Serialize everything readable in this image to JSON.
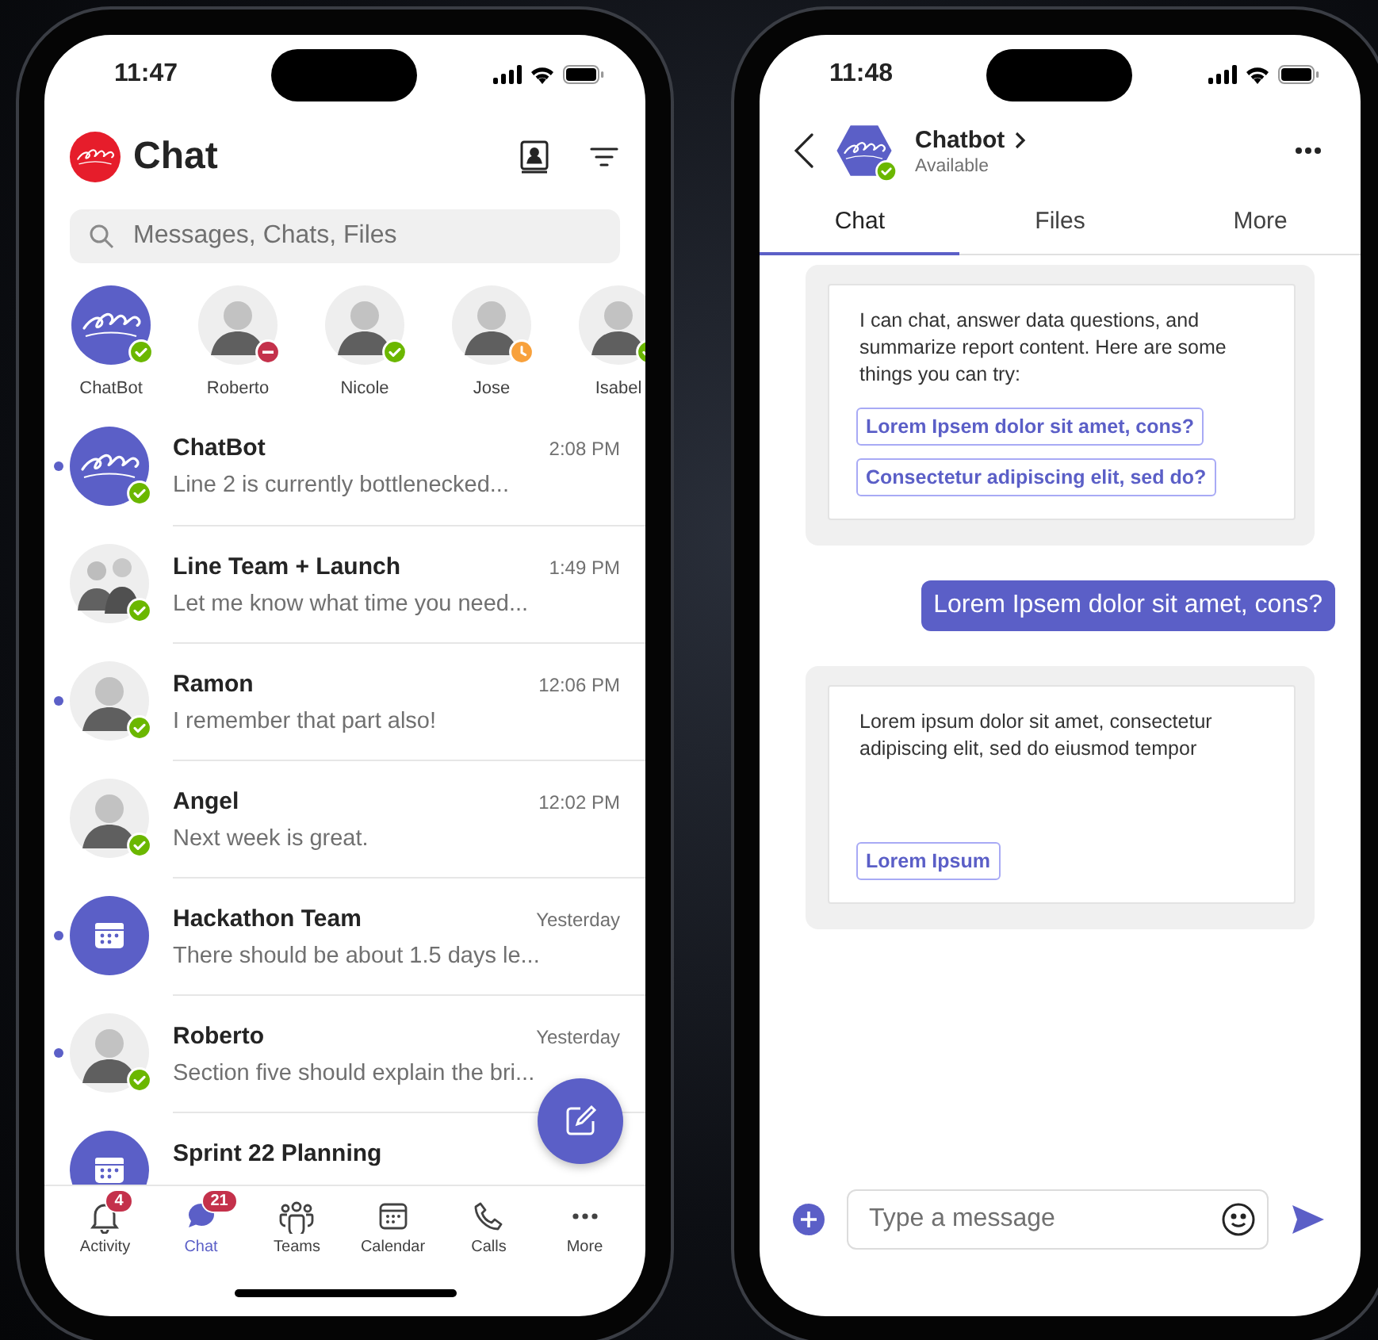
{
  "chat_list_screen": {
    "status_bar": {
      "time": "11:47"
    },
    "header": {
      "title": "Chat"
    },
    "search": {
      "placeholder": "Messages, Chats, Files"
    },
    "contacts": [
      {
        "name": "ChatBot",
        "kind": "logo",
        "presence": {
          "kind": "available",
          "color": "#6bb700"
        }
      },
      {
        "name": "Roberto",
        "kind": "person",
        "presence": {
          "kind": "busy",
          "color": "#c4314b"
        }
      },
      {
        "name": "Nicole",
        "kind": "person",
        "presence": {
          "kind": "available",
          "color": "#6bb700"
        }
      },
      {
        "name": "Jose",
        "kind": "person",
        "presence": {
          "kind": "away",
          "color": "#f8a13c"
        }
      },
      {
        "name": "Isabel",
        "kind": "person",
        "presence": {
          "kind": "available",
          "color": "#6bb700"
        }
      }
    ],
    "chats": [
      {
        "name": "ChatBot",
        "time": "2:08 PM",
        "preview": "Line 2 is currently bottlenecked...",
        "unread": true,
        "kind": "logo",
        "presence": {
          "kind": "available",
          "color": "#6bb700"
        }
      },
      {
        "name": "Line Team + Launch",
        "time": "1:49 PM",
        "preview": "Let me know what time you need...",
        "unread": false,
        "kind": "group",
        "presence": {
          "kind": "available",
          "color": "#6bb700"
        }
      },
      {
        "name": "Ramon",
        "time": "12:06 PM",
        "preview": "I remember that part also!",
        "unread": true,
        "kind": "person",
        "presence": {
          "kind": "available",
          "color": "#6bb700"
        }
      },
      {
        "name": "Angel",
        "time": "12:02 PM",
        "preview": "Next week is great.",
        "unread": false,
        "kind": "person",
        "presence": {
          "kind": "available",
          "color": "#6bb700"
        }
      },
      {
        "name": "Hackathon Team",
        "time": "Yesterday",
        "preview": "There should be about 1.5 days le...",
        "unread": true,
        "kind": "calendar"
      },
      {
        "name": "Roberto",
        "time": "Yesterday",
        "preview": "Section five should explain the bri...",
        "unread": true,
        "kind": "person",
        "presence": {
          "kind": "available",
          "color": "#6bb700"
        }
      },
      {
        "name": "Sprint 22 Planning",
        "unread": false,
        "kind": "calendar"
      }
    ],
    "bottom_nav": [
      {
        "label": "Activity",
        "badge": "4",
        "selected": false
      },
      {
        "label": "Chat",
        "badge": "21",
        "selected": true
      },
      {
        "label": "Teams",
        "selected": false
      },
      {
        "label": "Calendar",
        "selected": false
      },
      {
        "label": "Calls",
        "selected": false
      },
      {
        "label": "More",
        "selected": false
      }
    ]
  },
  "conversation_screen": {
    "status_bar": {
      "time": "11:48"
    },
    "header": {
      "title": "Chatbot",
      "status": "Available",
      "presence": {
        "kind": "available",
        "color": "#6bb700"
      }
    },
    "tabs": [
      {
        "label": "Chat",
        "selected": true
      },
      {
        "label": "Files",
        "selected": false
      },
      {
        "label": "More",
        "selected": false
      }
    ],
    "messages": [
      {
        "kind": "bot_card",
        "text": "I can chat, answer data questions, and summarize report content. Here are some things you can try:",
        "actions": [
          "Lorem Ipsem dolor sit amet, cons?",
          "Consectetur adipiscing elit, sed do?"
        ]
      },
      {
        "kind": "user",
        "text": "Lorem Ipsem dolor sit amet, cons?"
      },
      {
        "kind": "bot_card",
        "text": "Lorem ipsum dolor sit amet, consectetur adipiscing elit, sed do eiusmod tempor",
        "actions": [
          "Lorem Ipsum"
        ]
      }
    ],
    "composer": {
      "placeholder": "Type a message"
    }
  }
}
